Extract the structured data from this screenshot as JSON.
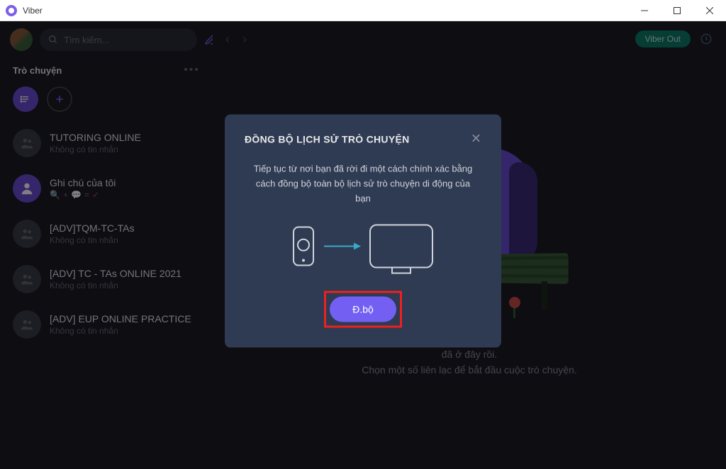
{
  "titlebar": {
    "title": "Viber"
  },
  "sidebar": {
    "search_placeholder": "Tìm kiếm...",
    "section_title": "Trò chuyện",
    "chats": [
      {
        "name": "TUTORING ONLINE",
        "sub": "Không có tin nhắn",
        "avatar": "group"
      },
      {
        "name": "Ghi chú của tôi",
        "sub_special": true,
        "avatar": "note"
      },
      {
        "name": "[ADV]TQM-TC-TAs",
        "sub": "Không có tin nhắn",
        "avatar": "group"
      },
      {
        "name": "[ADV] TC - TAs ONLINE 2021",
        "sub": "Không có tin nhắn",
        "avatar": "group"
      },
      {
        "name": "[ADV] EUP ONLINE PRACTICE",
        "sub": "Không có tin nhắn",
        "avatar": "group"
      }
    ]
  },
  "header": {
    "viber_out": "Viber Out"
  },
  "empty_state": {
    "line1": "đã ở đây rồi.",
    "line2": "Chọn một số liên lạc để bắt đầu cuộc trò chuyện."
  },
  "modal": {
    "title": "ĐỒNG BỘ LỊCH SỬ TRÒ CHUYỆN",
    "body": "Tiếp tục từ nơi bạn đã rời đi một cách chính xác bằng cách đồng bộ toàn bộ lịch sử trò chuyện di động của bạn",
    "button": "Đ.bộ"
  }
}
